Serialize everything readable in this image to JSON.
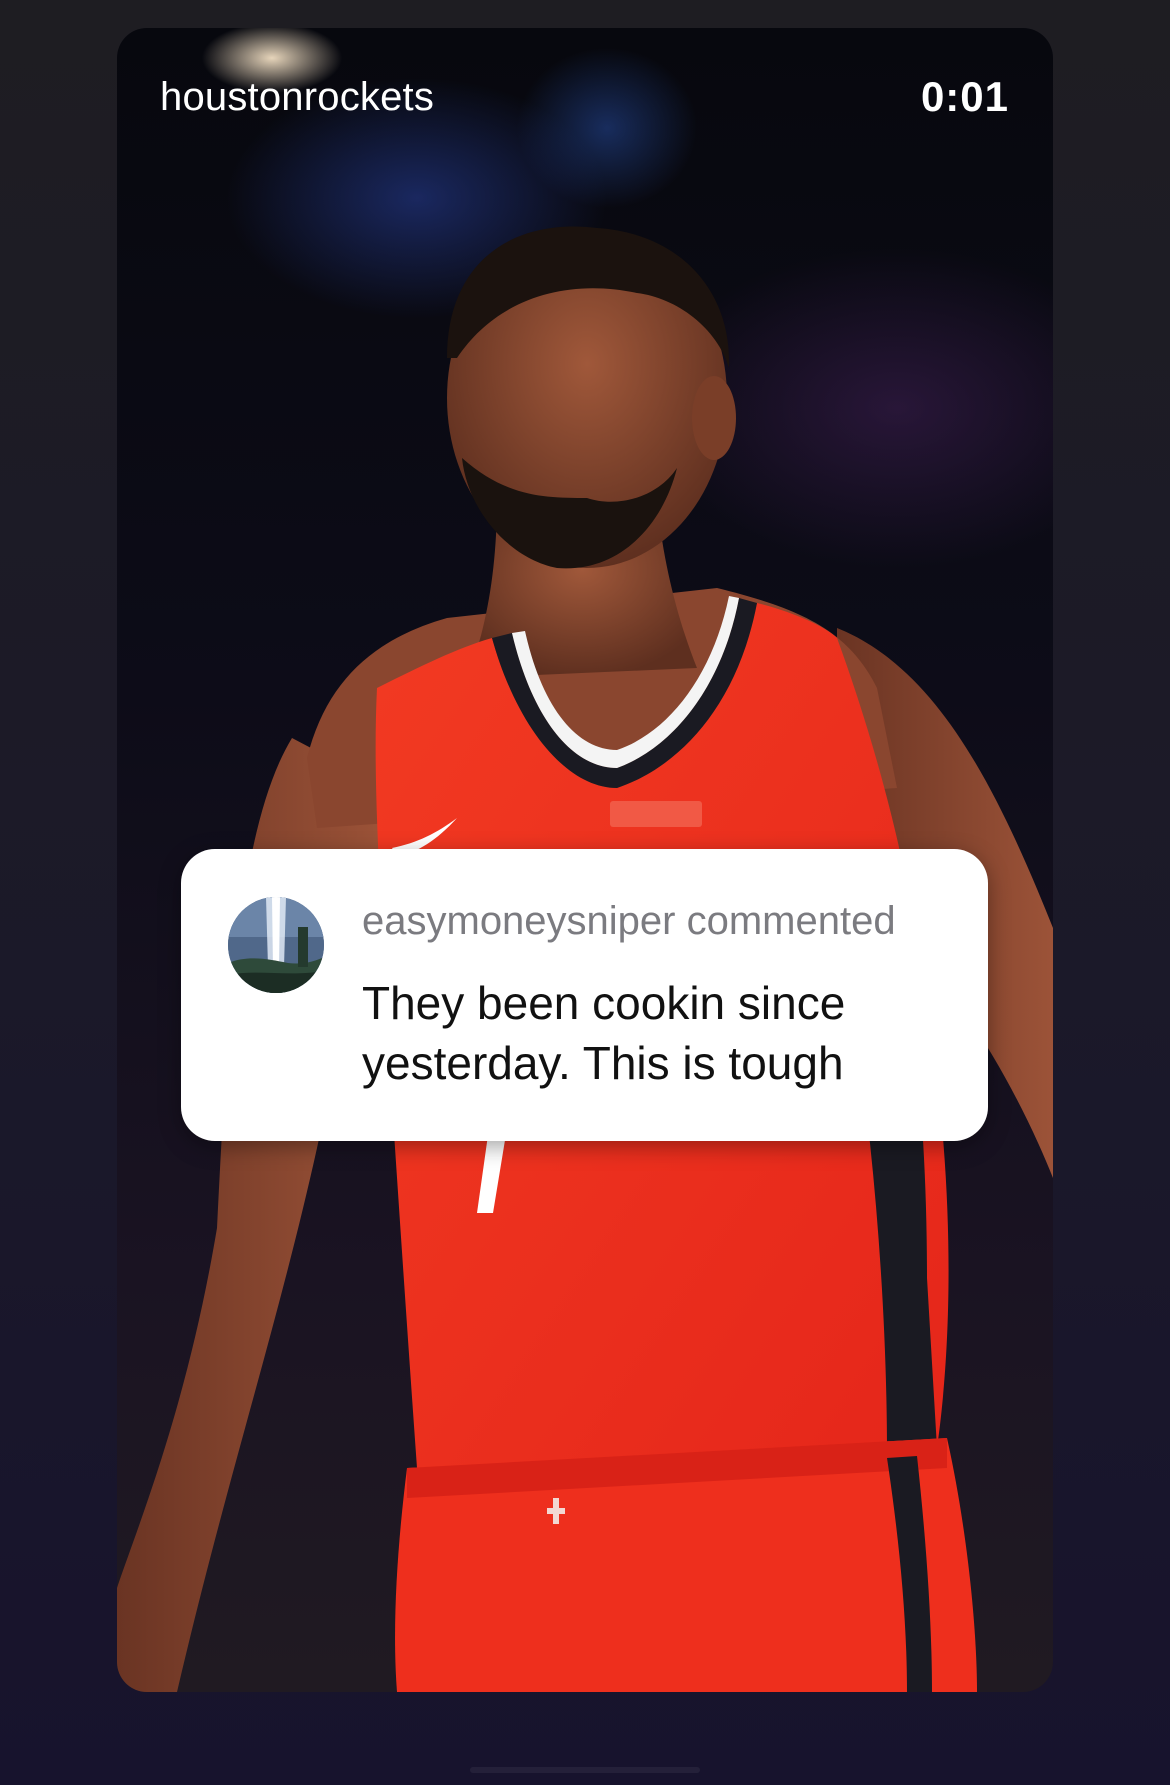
{
  "story": {
    "username": "houstonrockets",
    "timer": "0:01"
  },
  "comment": {
    "commenter_line": "easymoneysniper commented",
    "text": "They been cookin since yesterday. This is tough"
  },
  "colors": {
    "jersey": "#ec2b1e",
    "jersey_trim": "#1a1a22",
    "card_background": "#ffffff",
    "commenter_gray": "#7b7b80"
  },
  "icons": [
    "avatar"
  ]
}
